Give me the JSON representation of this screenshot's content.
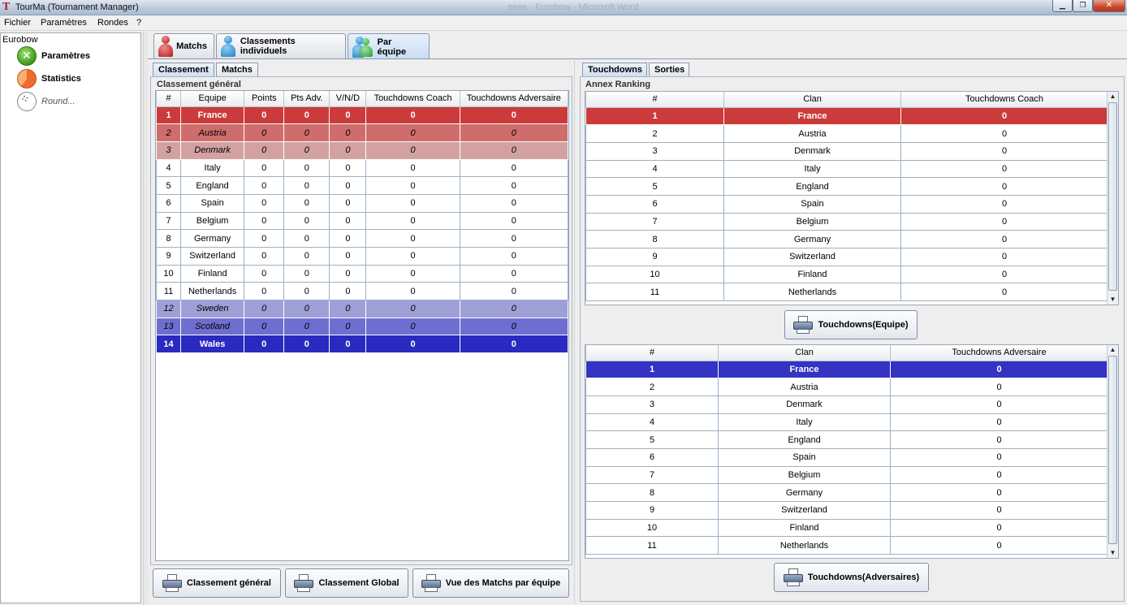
{
  "window": {
    "title": "TourMa (Tournament Manager)",
    "ghost_title": "eeee - Eurobow - Microsoft Word",
    "min_icon": "minimize-icon",
    "max_icon": "maximize-icon",
    "close_icon": "close-icon",
    "min_glyph": "▁",
    "max_glyph": "❐",
    "close_glyph": "✕"
  },
  "menu": [
    "Fichier",
    "Paramètres",
    "Rondes",
    "?"
  ],
  "tree": {
    "root": "Eurobow",
    "items": [
      {
        "label": "Paramètres",
        "icon": "tools-icon"
      },
      {
        "label": "Statistics",
        "icon": "pie-chart-icon"
      },
      {
        "label": "Round...",
        "icon": "dice-icon"
      }
    ]
  },
  "top_tabs": [
    {
      "label": "Matchs",
      "icon": "red-person-icon"
    },
    {
      "label": "Classements individuels",
      "icon": "blue-person-icon"
    },
    {
      "label": "Par équipe",
      "icon": "team-icon",
      "active": true
    }
  ],
  "left_panel": {
    "subtabs": [
      {
        "label": "Classement",
        "active": true
      },
      {
        "label": "Matchs"
      }
    ],
    "group_title": "Classement général",
    "columns": [
      "#",
      "Equipe",
      "Points",
      "Pts Adv.",
      "V/N/D",
      "Touchdowns Coach",
      "Touchdowns Adversaire"
    ],
    "rows": [
      [
        "1",
        "France",
        "0",
        "0",
        "0",
        "0",
        "0"
      ],
      [
        "2",
        "Austria",
        "0",
        "0",
        "0",
        "0",
        "0"
      ],
      [
        "3",
        "Denmark",
        "0",
        "0",
        "0",
        "0",
        "0"
      ],
      [
        "4",
        "Italy",
        "0",
        "0",
        "0",
        "0",
        "0"
      ],
      [
        "5",
        "England",
        "0",
        "0",
        "0",
        "0",
        "0"
      ],
      [
        "6",
        "Spain",
        "0",
        "0",
        "0",
        "0",
        "0"
      ],
      [
        "7",
        "Belgium",
        "0",
        "0",
        "0",
        "0",
        "0"
      ],
      [
        "8",
        "Germany",
        "0",
        "0",
        "0",
        "0",
        "0"
      ],
      [
        "9",
        "Switzerland",
        "0",
        "0",
        "0",
        "0",
        "0"
      ],
      [
        "10",
        "Finland",
        "0",
        "0",
        "0",
        "0",
        "0"
      ],
      [
        "11",
        "Netherlands",
        "0",
        "0",
        "0",
        "0",
        "0"
      ],
      [
        "12",
        "Sweden",
        "0",
        "0",
        "0",
        "0",
        "0"
      ],
      [
        "13",
        "Scotland",
        "0",
        "0",
        "0",
        "0",
        "0"
      ],
      [
        "14",
        "Wales",
        "0",
        "0",
        "0",
        "0",
        "0"
      ]
    ],
    "buttons": [
      "Classement général",
      "Classement Global",
      "Vue des Matchs par équipe"
    ]
  },
  "right_panel": {
    "subtabs": [
      {
        "label": "Touchdowns",
        "active": true
      },
      {
        "label": "Sorties"
      }
    ],
    "group_title": "Annex Ranking",
    "coach_table": {
      "columns": [
        "#",
        "Clan",
        "Touchdowns Coach"
      ],
      "rows": [
        [
          "1",
          "France",
          "0"
        ],
        [
          "2",
          "Austria",
          "0"
        ],
        [
          "3",
          "Denmark",
          "0"
        ],
        [
          "4",
          "Italy",
          "0"
        ],
        [
          "5",
          "England",
          "0"
        ],
        [
          "6",
          "Spain",
          "0"
        ],
        [
          "7",
          "Belgium",
          "0"
        ],
        [
          "8",
          "Germany",
          "0"
        ],
        [
          "9",
          "Switzerland",
          "0"
        ],
        [
          "10",
          "Finland",
          "0"
        ],
        [
          "11",
          "Netherlands",
          "0"
        ]
      ],
      "button": "Touchdowns(Equipe)"
    },
    "adv_table": {
      "columns": [
        "#",
        "Clan",
        "Touchdowns Adversaire"
      ],
      "rows": [
        [
          "1",
          "France",
          "0"
        ],
        [
          "2",
          "Austria",
          "0"
        ],
        [
          "3",
          "Denmark",
          "0"
        ],
        [
          "4",
          "Italy",
          "0"
        ],
        [
          "5",
          "England",
          "0"
        ],
        [
          "6",
          "Spain",
          "0"
        ],
        [
          "7",
          "Belgium",
          "0"
        ],
        [
          "8",
          "Germany",
          "0"
        ],
        [
          "9",
          "Switzerland",
          "0"
        ],
        [
          "10",
          "Finland",
          "0"
        ],
        [
          "11",
          "Netherlands",
          "0"
        ]
      ],
      "button": "Touchdowns(Adversaires)"
    }
  },
  "scroll": {
    "up_glyph": "▲",
    "down_glyph": "▼"
  },
  "colors": {
    "rank_top": "#cc3b3b",
    "rank_bottom": "#2a2ac0",
    "selection_blue": "#3333c4"
  }
}
